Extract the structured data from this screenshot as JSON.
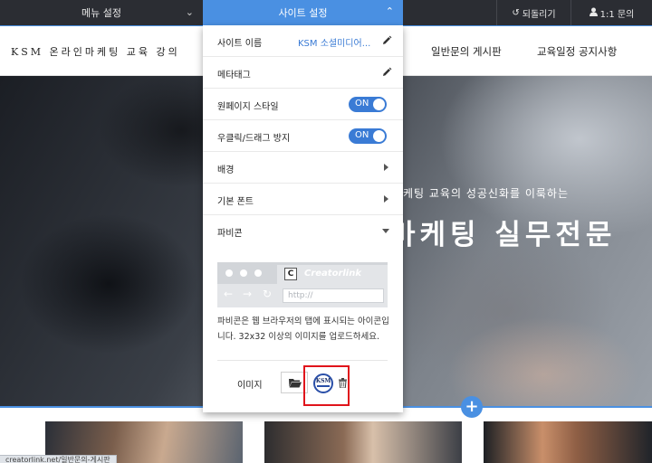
{
  "topbar": {
    "menu_settings": "메뉴 설정",
    "site_settings": "사이트 설정",
    "undo": "되돌리기",
    "inquiry": "1:1 문의"
  },
  "header": {
    "logo": "KSM 온라인마케팅 교육 강의",
    "nav": [
      "일반문의 게시판",
      "교육일정 공지사항"
    ]
  },
  "hero": {
    "subtitle": "케팅 교육의 성공신화를 이룩하는",
    "title": "마케팅 실무전문"
  },
  "panel": {
    "site_name_label": "사이트 이름",
    "site_name_value": "KSM 소셜미디어...",
    "meta_tag_label": "메타태그",
    "onepage_label": "원페이지 스타일",
    "onepage_toggle": "ON",
    "rightclick_label": "우클릭/드래그 방지",
    "rightclick_toggle": "ON",
    "background_label": "배경",
    "font_label": "기본 폰트",
    "favicon_label": "파비콘",
    "preview_tab_name": "Creatorlink",
    "preview_url": "http://",
    "favicon_desc": "파비콘은 웹 브라우저의 탭에 표시되는 아이콘입니다. 32x32 이상의 이미지를 업로드하세요.",
    "image_label": "이미지",
    "ksm_logo_text": "KSM"
  },
  "statusbar": {
    "url": "creatorlink.net/일반문의-게시판"
  },
  "colors": {
    "accent": "#4a90e2",
    "toggle": "#3a7bd5",
    "highlight": "#e0141b",
    "topbar": "#2b2d33"
  }
}
